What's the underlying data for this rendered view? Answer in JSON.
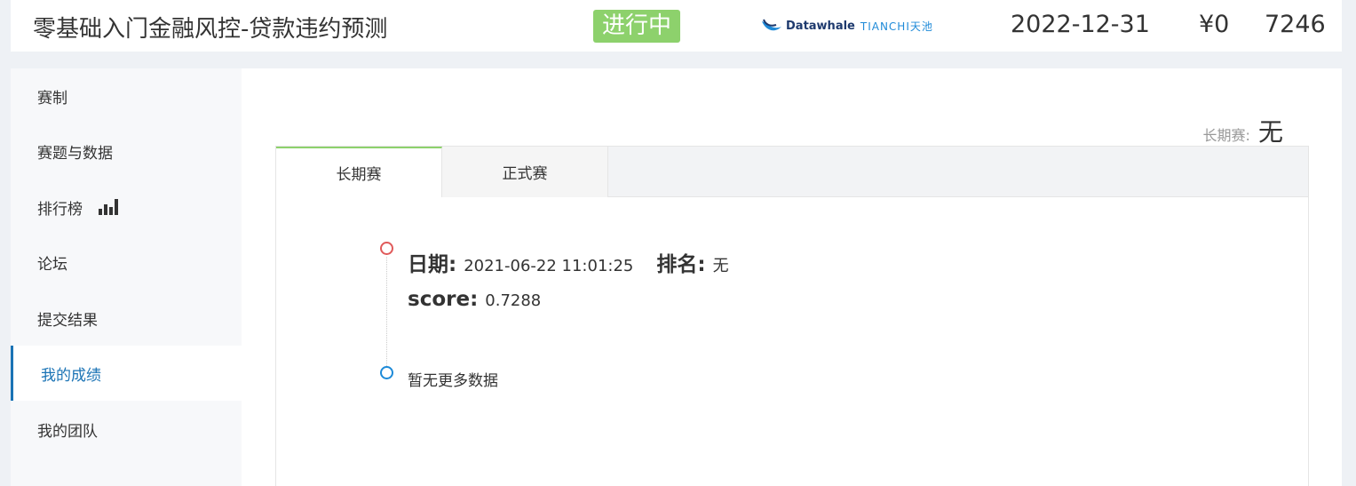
{
  "header": {
    "competition_title": "零基础入门金融风控-贷款违约预测",
    "status_badge": "进行中",
    "sponsor_name": "Datawhale",
    "platform_name": "TIANCHI天池",
    "deadline": "2022-12-31",
    "prize": "¥0",
    "team_count": "7246",
    "badge_color": "#8dd16c"
  },
  "sidebar": {
    "items": [
      {
        "label": "赛制"
      },
      {
        "label": "赛题与数据"
      },
      {
        "label": "排行榜",
        "icon": "bar-chart-icon"
      },
      {
        "label": "论坛"
      },
      {
        "label": "提交结果"
      },
      {
        "label": "我的成绩",
        "active": true
      },
      {
        "label": "我的团队"
      }
    ],
    "active_color": "#1a73b5"
  },
  "main": {
    "long_term_label": "长期赛:",
    "long_term_value": "无",
    "tabs": [
      {
        "label": "长期赛",
        "active": true
      },
      {
        "label": "正式赛",
        "active": false
      }
    ],
    "record": {
      "date_key": "日期:",
      "date_value": "2021-06-22 11:01:25",
      "rank_key": "排名:",
      "rank_value": "无",
      "score_key": "score:",
      "score_value": "0.7288"
    },
    "no_more_data": "暂无更多数据"
  }
}
